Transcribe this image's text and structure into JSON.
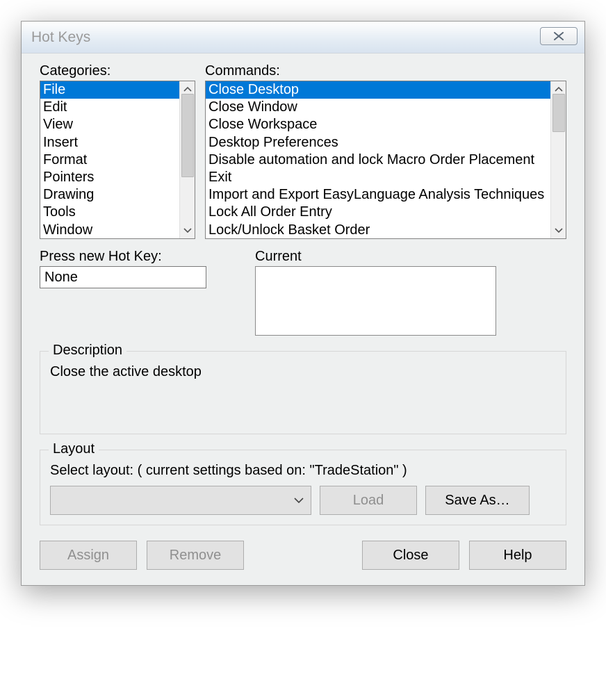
{
  "title": "Hot Keys",
  "labels": {
    "categories": "Categories:",
    "commands": "Commands:",
    "press_new": "Press new Hot Key:",
    "current": "Current",
    "description": "Description",
    "layout": "Layout",
    "select_layout": "Select layout:  ( current settings based on: \"TradeStation\" )"
  },
  "categories": {
    "items": [
      "File",
      "Edit",
      "View",
      "Insert",
      "Format",
      "Pointers",
      "Drawing",
      "Tools",
      "Window"
    ],
    "selected_index": 0
  },
  "commands": {
    "items": [
      "Close Desktop",
      "Close Window",
      "Close Workspace",
      "Desktop Preferences",
      "Disable automation and lock Macro Order Placement",
      "Exit",
      "Import and Export EasyLanguage Analysis Techniques",
      "Lock All Order Entry",
      "Lock/Unlock Basket Order"
    ],
    "selected_index": 0
  },
  "press_new_value": "None",
  "current_value": "",
  "description_text": "Close the active desktop",
  "layout_combo_value": "",
  "buttons": {
    "load": "Load",
    "saveas": "Save As…",
    "assign": "Assign",
    "remove": "Remove",
    "close": "Close",
    "help": "Help"
  }
}
